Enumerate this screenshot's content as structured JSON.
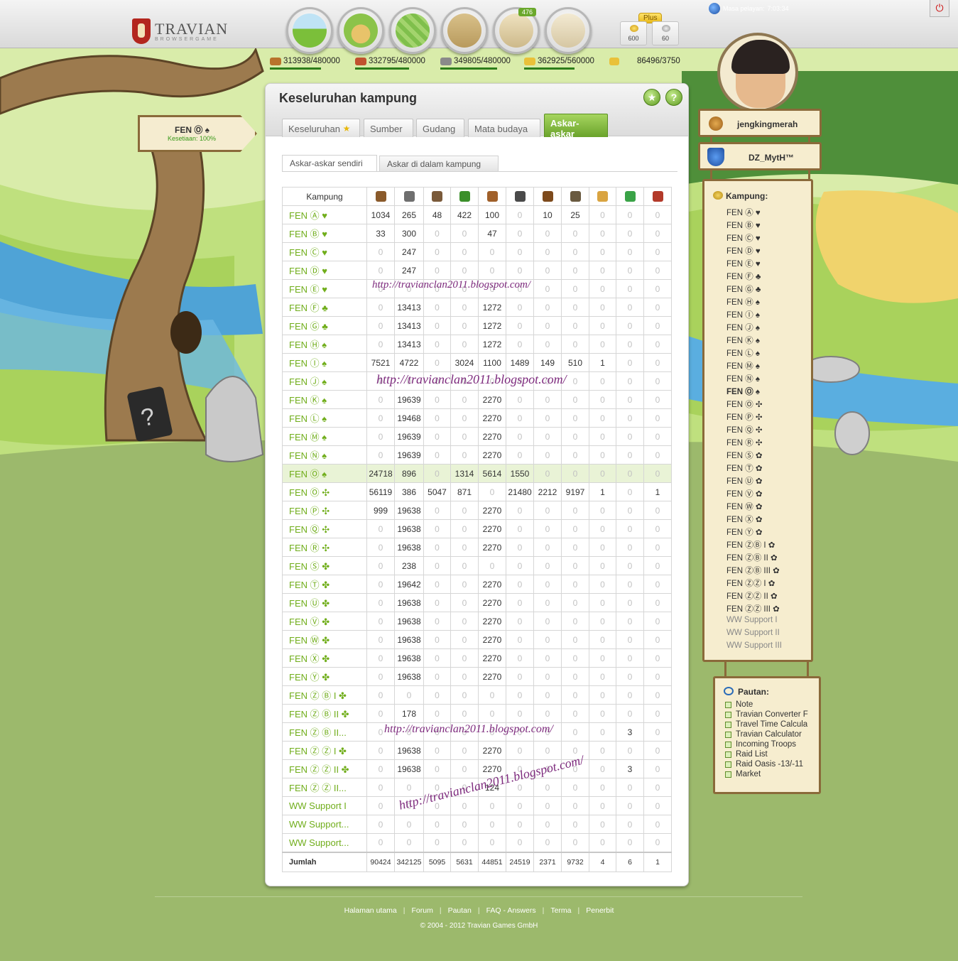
{
  "topbar": {
    "logo_text": "TRAVIAN",
    "logo_sub": "BROWSERGAME",
    "nav_badge": "476",
    "plus_label": "Plus",
    "gold": "600",
    "silver": "60",
    "server_time_label": "Masa pelayan:",
    "server_time": "7:03:34"
  },
  "resources": {
    "wood": "313938/480000",
    "clay": "332795/480000",
    "iron": "349805/480000",
    "crop": "362925/560000",
    "consumption": "86496/3750"
  },
  "resource_fill": {
    "wood": 0.654,
    "clay": 0.693,
    "iron": 0.729,
    "crop": 0.648
  },
  "page": {
    "title": "Keseluruhan kampung",
    "tabs": [
      "Keseluruhan",
      "Sumber",
      "Gudang",
      "Mata budaya",
      "Askar-askar"
    ],
    "subtabs": [
      "Askar-askar sendiri",
      "Askar di dalam kampung"
    ]
  },
  "table": {
    "header": "Kampung",
    "unit_icons": [
      "clubswinger-icon",
      "spearman-icon",
      "axeman-icon",
      "scout-icon",
      "paladin-icon",
      "teutonic-knight-icon",
      "ram-icon",
      "catapult-icon",
      "chief-icon",
      "settler-icon",
      "hero-icon"
    ],
    "rows": [
      {
        "name": "FEN Ⓐ ♥",
        "v": [
          1034,
          265,
          48,
          422,
          100,
          0,
          10,
          25,
          0,
          0,
          0
        ]
      },
      {
        "name": "FEN Ⓑ ♥",
        "v": [
          33,
          300,
          0,
          0,
          47,
          0,
          0,
          0,
          0,
          0,
          0
        ]
      },
      {
        "name": "FEN Ⓒ ♥",
        "v": [
          0,
          247,
          0,
          0,
          0,
          0,
          0,
          0,
          0,
          0,
          0
        ]
      },
      {
        "name": "FEN Ⓓ ♥",
        "v": [
          0,
          247,
          0,
          0,
          0,
          0,
          0,
          0,
          0,
          0,
          0
        ]
      },
      {
        "name": "FEN Ⓔ ♥",
        "v": [
          0,
          0,
          0,
          0,
          0,
          0,
          0,
          0,
          0,
          0,
          0
        ]
      },
      {
        "name": "FEN Ⓕ ♣",
        "v": [
          0,
          13413,
          0,
          0,
          1272,
          0,
          0,
          0,
          0,
          0,
          0
        ]
      },
      {
        "name": "FEN Ⓖ ♣",
        "v": [
          0,
          13413,
          0,
          0,
          1272,
          0,
          0,
          0,
          0,
          0,
          0
        ]
      },
      {
        "name": "FEN Ⓗ ♠",
        "v": [
          0,
          13413,
          0,
          0,
          1272,
          0,
          0,
          0,
          0,
          0,
          0
        ]
      },
      {
        "name": "FEN Ⓘ ♠",
        "v": [
          7521,
          4722,
          0,
          3024,
          1100,
          1489,
          149,
          510,
          1,
          0,
          0
        ]
      },
      {
        "name": "FEN Ⓙ ♠",
        "v": [
          0,
          0,
          0,
          0,
          0,
          0,
          0,
          0,
          0,
          0,
          0
        ]
      },
      {
        "name": "FEN Ⓚ ♠",
        "v": [
          0,
          19639,
          0,
          0,
          2270,
          0,
          0,
          0,
          0,
          0,
          0
        ]
      },
      {
        "name": "FEN Ⓛ ♠",
        "v": [
          0,
          19468,
          0,
          0,
          2270,
          0,
          0,
          0,
          0,
          0,
          0
        ]
      },
      {
        "name": "FEN Ⓜ ♠",
        "v": [
          0,
          19639,
          0,
          0,
          2270,
          0,
          0,
          0,
          0,
          0,
          0
        ]
      },
      {
        "name": "FEN Ⓝ ♠",
        "v": [
          0,
          19639,
          0,
          0,
          2270,
          0,
          0,
          0,
          0,
          0,
          0
        ]
      },
      {
        "name": "FEN Ⓞ ♠",
        "v": [
          24718,
          896,
          0,
          1314,
          5614,
          1550,
          0,
          0,
          0,
          0,
          0
        ],
        "current": true
      },
      {
        "name": "FEN Ⓞ ✣",
        "v": [
          56119,
          386,
          5047,
          871,
          0,
          21480,
          2212,
          9197,
          1,
          0,
          1
        ]
      },
      {
        "name": "FEN Ⓟ ✣",
        "v": [
          999,
          19638,
          0,
          0,
          2270,
          0,
          0,
          0,
          0,
          0,
          0
        ]
      },
      {
        "name": "FEN Ⓠ ✣",
        "v": [
          0,
          19638,
          0,
          0,
          2270,
          0,
          0,
          0,
          0,
          0,
          0
        ]
      },
      {
        "name": "FEN Ⓡ ✣",
        "v": [
          0,
          19638,
          0,
          0,
          2270,
          0,
          0,
          0,
          0,
          0,
          0
        ]
      },
      {
        "name": "FEN Ⓢ ✤",
        "v": [
          0,
          238,
          0,
          0,
          0,
          0,
          0,
          0,
          0,
          0,
          0
        ]
      },
      {
        "name": "FEN Ⓣ ✤",
        "v": [
          0,
          19642,
          0,
          0,
          2270,
          0,
          0,
          0,
          0,
          0,
          0
        ]
      },
      {
        "name": "FEN Ⓤ ✤",
        "v": [
          0,
          19638,
          0,
          0,
          2270,
          0,
          0,
          0,
          0,
          0,
          0
        ]
      },
      {
        "name": "FEN Ⓥ ✤",
        "v": [
          0,
          19638,
          0,
          0,
          2270,
          0,
          0,
          0,
          0,
          0,
          0
        ]
      },
      {
        "name": "FEN Ⓦ ✤",
        "v": [
          0,
          19638,
          0,
          0,
          2270,
          0,
          0,
          0,
          0,
          0,
          0
        ]
      },
      {
        "name": "FEN Ⓧ ✤",
        "v": [
          0,
          19638,
          0,
          0,
          2270,
          0,
          0,
          0,
          0,
          0,
          0
        ]
      },
      {
        "name": "FEN Ⓨ ✤",
        "v": [
          0,
          19638,
          0,
          0,
          2270,
          0,
          0,
          0,
          0,
          0,
          0
        ]
      },
      {
        "name": "FEN Ⓩ Ⓑ I ✤",
        "v": [
          0,
          0,
          0,
          0,
          0,
          0,
          0,
          0,
          0,
          0,
          0
        ]
      },
      {
        "name": "FEN Ⓩ Ⓑ II ✤",
        "v": [
          0,
          178,
          0,
          0,
          0,
          0,
          0,
          0,
          0,
          0,
          0
        ]
      },
      {
        "name": "FEN Ⓩ Ⓑ II...",
        "v": [
          0,
          0,
          0,
          0,
          0,
          0,
          0,
          0,
          0,
          3,
          0
        ]
      },
      {
        "name": "FEN Ⓩ Ⓩ I ✤",
        "v": [
          0,
          19638,
          0,
          0,
          2270,
          0,
          0,
          0,
          0,
          0,
          0
        ]
      },
      {
        "name": "FEN Ⓩ Ⓩ II ✤",
        "v": [
          0,
          19638,
          0,
          0,
          2270,
          0,
          0,
          0,
          0,
          3,
          0
        ]
      },
      {
        "name": "FEN Ⓩ Ⓩ II...",
        "v": [
          0,
          0,
          0,
          0,
          124,
          0,
          0,
          0,
          0,
          0,
          0
        ]
      },
      {
        "name": "WW Support I",
        "v": [
          0,
          0,
          0,
          0,
          0,
          0,
          0,
          0,
          0,
          0,
          0
        ]
      },
      {
        "name": "WW Support...",
        "v": [
          0,
          0,
          0,
          0,
          0,
          0,
          0,
          0,
          0,
          0,
          0
        ]
      },
      {
        "name": "WW Support...",
        "v": [
          0,
          0,
          0,
          0,
          0,
          0,
          0,
          0,
          0,
          0,
          0
        ]
      }
    ],
    "sum_label": "Jumlah",
    "sum": [
      90424,
      342125,
      5095,
      5631,
      44851,
      24519,
      2371,
      9732,
      4,
      6,
      1
    ]
  },
  "watermark": "http://travianclan2011.blogspot.com/",
  "village_sign": {
    "name": "FEN Ⓞ ♠",
    "loyalty": "Kesetiaan: 100%"
  },
  "player": {
    "name": "jengkingmerah",
    "alliance": "DZ_MytH™"
  },
  "village_list": {
    "title": "Kampung:",
    "items": [
      "FEN Ⓐ ♥",
      "FEN Ⓑ ♥",
      "FEN Ⓒ ♥",
      "FEN Ⓓ ♥",
      "FEN Ⓔ ♥",
      "FEN Ⓕ ♣",
      "FEN Ⓖ ♣",
      "FEN Ⓗ ♠",
      "FEN Ⓘ ♠",
      "FEN Ⓙ ♠",
      "FEN Ⓚ ♠",
      "FEN Ⓛ ♠",
      "FEN Ⓜ ♠",
      "FEN Ⓝ ♠",
      "FEN Ⓞ ♠",
      "FEN Ⓞ ✣",
      "FEN Ⓟ ✣",
      "FEN Ⓠ ✣",
      "FEN Ⓡ ✣",
      "FEN Ⓢ ✿",
      "FEN Ⓣ ✿",
      "FEN Ⓤ ✿",
      "FEN Ⓥ ✿",
      "FEN Ⓦ ✿",
      "FEN Ⓧ ✿",
      "FEN Ⓨ ✿",
      "FEN ⓏⒷ I ✿",
      "FEN ⓏⒷ II ✿",
      "FEN ⓏⒷ III ✿",
      "FEN ⓏⓏ I ✿",
      "FEN ⓏⓏ II ✿",
      "FEN ⓏⓏ III ✿",
      "WW Support I",
      "WW Support II",
      "WW Support III"
    ],
    "current_index": 14
  },
  "links": {
    "title": "Pautan:",
    "items": [
      "Note",
      "Travian Converter F",
      "Travel Time Calcula",
      "Travian Calculator",
      "Incoming Troops",
      "Raid List",
      "Raid Oasis -13/-11",
      "Market"
    ]
  },
  "footer": {
    "links": [
      "Halaman utama",
      "Forum",
      "Pautan",
      "FAQ - Answers",
      "Terma",
      "Penerbit"
    ],
    "copyright": "© 2004 - 2012 Travian Games GmbH"
  },
  "colors": {
    "accent_green": "#71ae1c",
    "tab_active": "#7ab535",
    "village_current_bg": "#e9f3d6"
  }
}
